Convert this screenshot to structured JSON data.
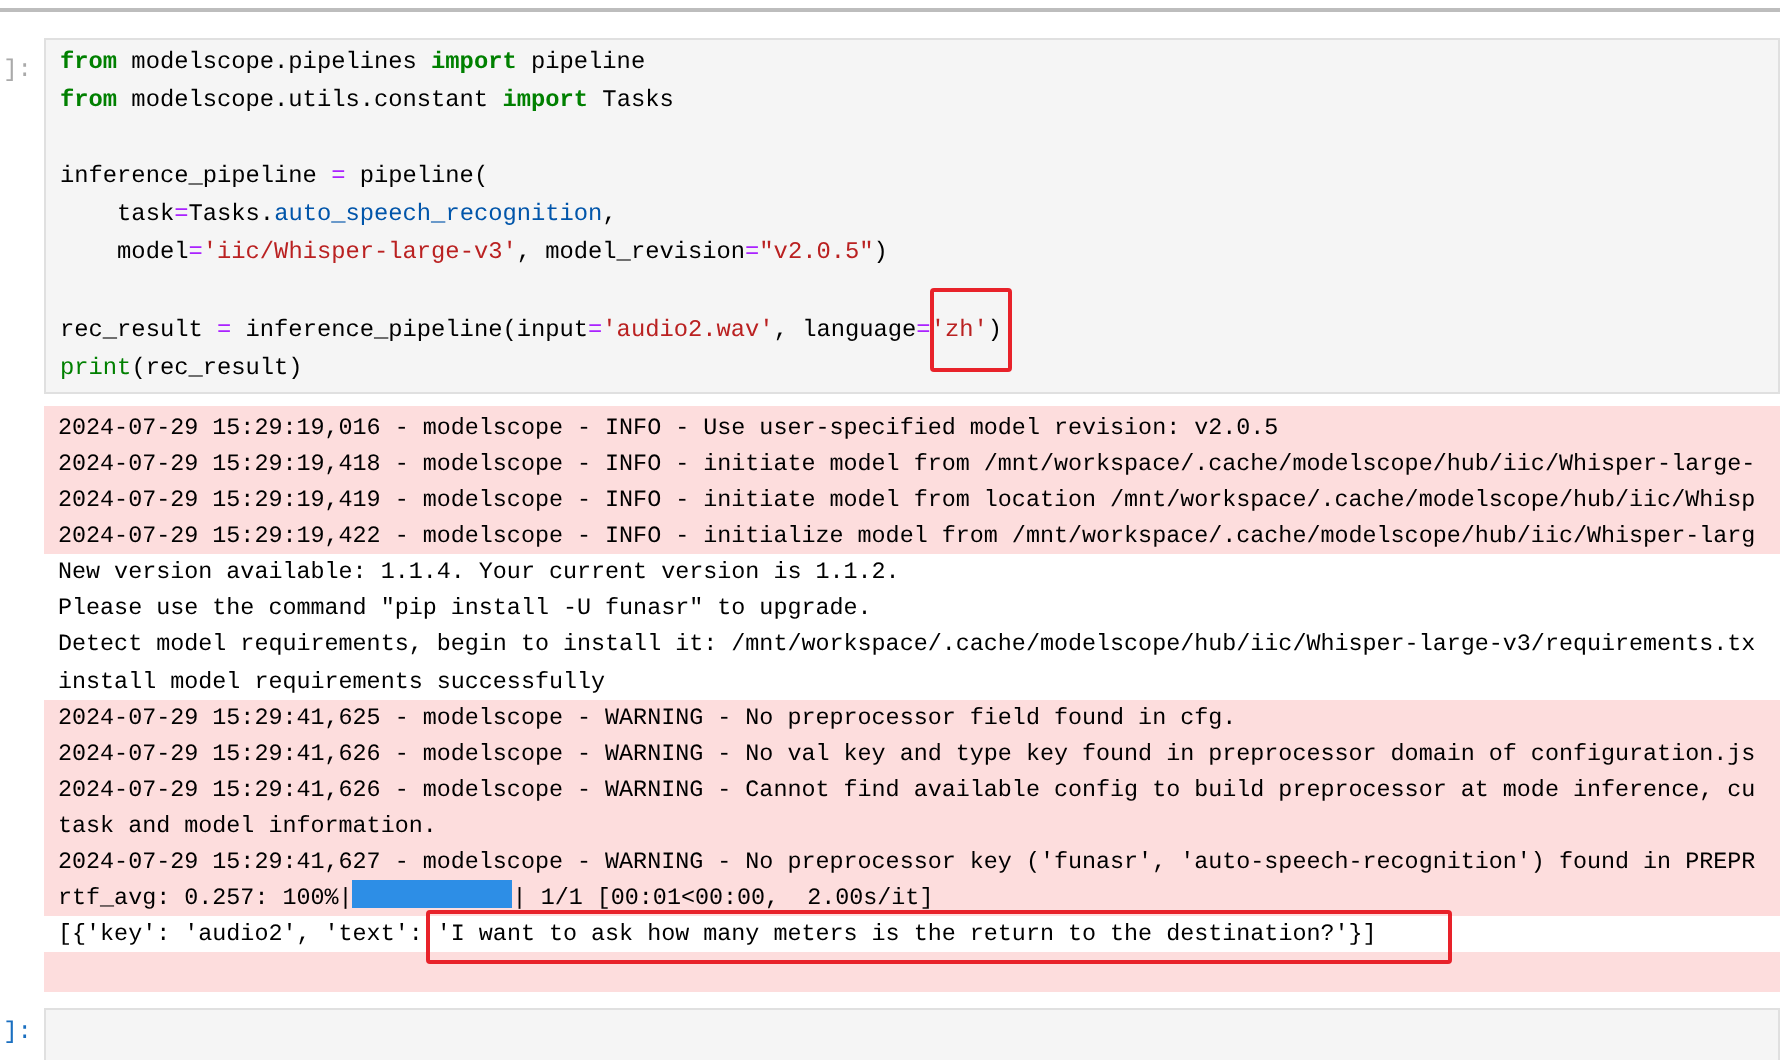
{
  "cells": [
    {
      "prompt": "]:",
      "prompt_active": false,
      "code_blocks": [
        [
          [
            {
              "t": "from",
              "kind": "kw"
            },
            {
              "t": " modelscope.pipelines ",
              "kind": "plain"
            },
            {
              "t": "import",
              "kind": "kw"
            },
            {
              "t": " pipeline",
              "kind": "plain"
            }
          ],
          [
            {
              "t": "from",
              "kind": "kw"
            },
            {
              "t": " modelscope.utils.constant ",
              "kind": "plain"
            },
            {
              "t": "import",
              "kind": "kw"
            },
            {
              "t": " Tasks",
              "kind": "plain"
            }
          ]
        ],
        [
          [
            {
              "t": "inference_pipeline ",
              "kind": "plain"
            },
            {
              "t": "=",
              "kind": "op"
            },
            {
              "t": " pipeline(",
              "kind": "plain"
            }
          ],
          [
            {
              "t": "    task",
              "kind": "plain"
            },
            {
              "t": "=",
              "kind": "op"
            },
            {
              "t": "Tasks.",
              "kind": "plain"
            },
            {
              "t": "auto_speech_recognition",
              "kind": "attr"
            },
            {
              "t": ",",
              "kind": "plain"
            }
          ],
          [
            {
              "t": "    model",
              "kind": "plain"
            },
            {
              "t": "=",
              "kind": "op"
            },
            {
              "t": "'iic/Whisper-large-v3'",
              "kind": "str"
            },
            {
              "t": ", model_revision",
              "kind": "plain"
            },
            {
              "t": "=",
              "kind": "op"
            },
            {
              "t": "\"v2.0.5\"",
              "kind": "str"
            },
            {
              "t": ")",
              "kind": "plain"
            }
          ]
        ],
        [
          [
            {
              "t": "rec_result ",
              "kind": "plain"
            },
            {
              "t": "=",
              "kind": "op"
            },
            {
              "t": " inference_pipeline(input",
              "kind": "plain"
            },
            {
              "t": "=",
              "kind": "op"
            },
            {
              "t": "'audio2.wav'",
              "kind": "str"
            },
            {
              "t": ", language",
              "kind": "plain"
            },
            {
              "t": "=",
              "kind": "op"
            },
            {
              "t": "'zh'",
              "kind": "str",
              "highlighted": true
            },
            {
              "t": ")",
              "kind": "plain"
            }
          ],
          [
            {
              "t": "print",
              "kind": "builtin"
            },
            {
              "t": "(rec_result)",
              "kind": "plain"
            }
          ]
        ]
      ],
      "outputs": [
        {
          "kind": "stderr",
          "lines": [
            [
              {
                "t": "2024-07-29 15:29:19,016 - modelscope - INFO - Use user-specified model revision: v2.0.5",
                "kind": "text"
              }
            ],
            [
              {
                "t": "2024-07-29 15:29:19,418 - modelscope - INFO - initiate model from /mnt/workspace/.cache/modelscope/hub/iic/Whisper-large-",
                "kind": "text"
              }
            ],
            [
              {
                "t": "2024-07-29 15:29:19,419 - modelscope - INFO - initiate model from location /mnt/workspace/.cache/modelscope/hub/iic/Whisp",
                "kind": "text"
              }
            ],
            [
              {
                "t": "2024-07-29 15:29:19,422 - modelscope - INFO - initialize model from /mnt/workspace/.cache/modelscope/hub/iic/Whisper-larg",
                "kind": "text"
              }
            ]
          ]
        },
        {
          "kind": "stdout",
          "lines": [
            [
              {
                "t": "New version available: 1.1.4. Your current version is 1.1.2.",
                "kind": "text"
              }
            ],
            [
              {
                "t": "Please use the command \"pip install -U funasr\" to upgrade.",
                "kind": "text"
              }
            ],
            [
              {
                "t": "Detect model requirements, begin to install it: /mnt/workspace/.cache/modelscope/hub/iic/Whisper-large-v3/requirements.tx",
                "kind": "text"
              }
            ],
            [
              {
                "t": "install model requirements successfully",
                "kind": "text"
              }
            ]
          ]
        },
        {
          "kind": "stderr",
          "lines": [
            [
              {
                "t": "2024-07-29 15:29:41,625 - modelscope - WARNING - No preprocessor field found in cfg.",
                "kind": "text"
              }
            ],
            [
              {
                "t": "2024-07-29 15:29:41,626 - modelscope - WARNING - No val key and type key found in preprocessor domain of configuration.js",
                "kind": "text"
              }
            ],
            [
              {
                "t": "2024-07-29 15:29:41,626 - modelscope - WARNING - Cannot find available config to build preprocessor at mode inference, cu",
                "kind": "text"
              }
            ],
            [
              {
                "t": "task and model information.",
                "kind": "text"
              }
            ],
            [
              {
                "t": "2024-07-29 15:29:41,627 - modelscope - WARNING - No preprocessor key ('funasr', 'auto-speech-recognition') found in PREPR",
                "kind": "text"
              }
            ],
            [
              {
                "t": "rtf_avg: 0.257: 100%|",
                "kind": "text"
              },
              {
                "kind": "bar",
                "level": 1
              },
              {
                "t": "| 1/1 [00:01<00:00,  2.00s/it]",
                "kind": "text"
              }
            ]
          ]
        },
        {
          "kind": "stdout",
          "lines": [
            [
              {
                "t": "[{'key': 'audio2', 'text': ",
                "kind": "text"
              },
              {
                "t": "'I want to ask how many meters is the return to the destination?'}]",
                "kind": "text",
                "highlighted": true
              }
            ]
          ]
        },
        {
          "kind": "stderr"
        }
      ]
    },
    {
      "prompt": "]:",
      "prompt_active": true
    }
  ]
}
